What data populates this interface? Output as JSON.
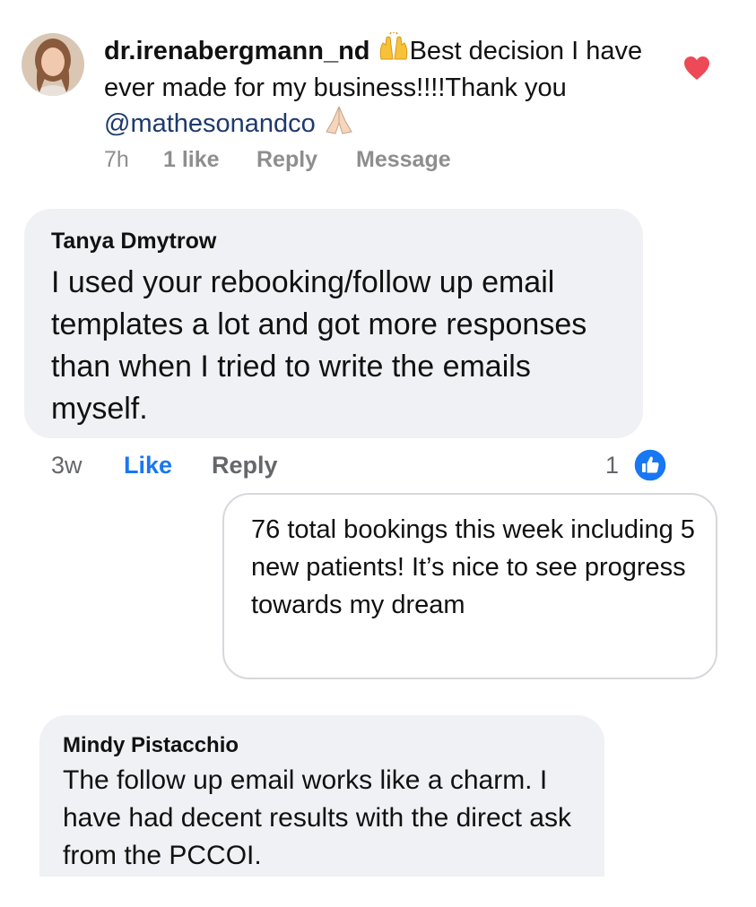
{
  "ig_comment": {
    "username": "dr.irenabergmann_nd",
    "emoji_hands": "raising-hands-emoji",
    "text_before_mention": "Best decision I have ever made for my business!!!!Thank you ",
    "mention": "@mathesonandco",
    "emoji_pray": "folded-hands-emoji",
    "time": "7h",
    "likes": "1 like",
    "reply_label": "Reply",
    "message_label": "Message",
    "liked": true,
    "heart_color": "#ed4956"
  },
  "fb_comment_1": {
    "author": "Tanya Dmytrow",
    "text": "I used your rebooking/follow up email templates a lot and got more responses than when I tried to write the emails myself.",
    "time": "3w",
    "like_label": "Like",
    "reply_label": "Reply",
    "reaction_count": "1",
    "like_color": "#1877f2"
  },
  "reply_box": {
    "text": "76 total bookings this week including 5 new patients! It’s nice to see progress towards my dream"
  },
  "fb_comment_2": {
    "author": "Mindy Pistacchio",
    "text": "The follow up email works like a charm.  I have had decent results with the direct ask from the PCCOI."
  }
}
